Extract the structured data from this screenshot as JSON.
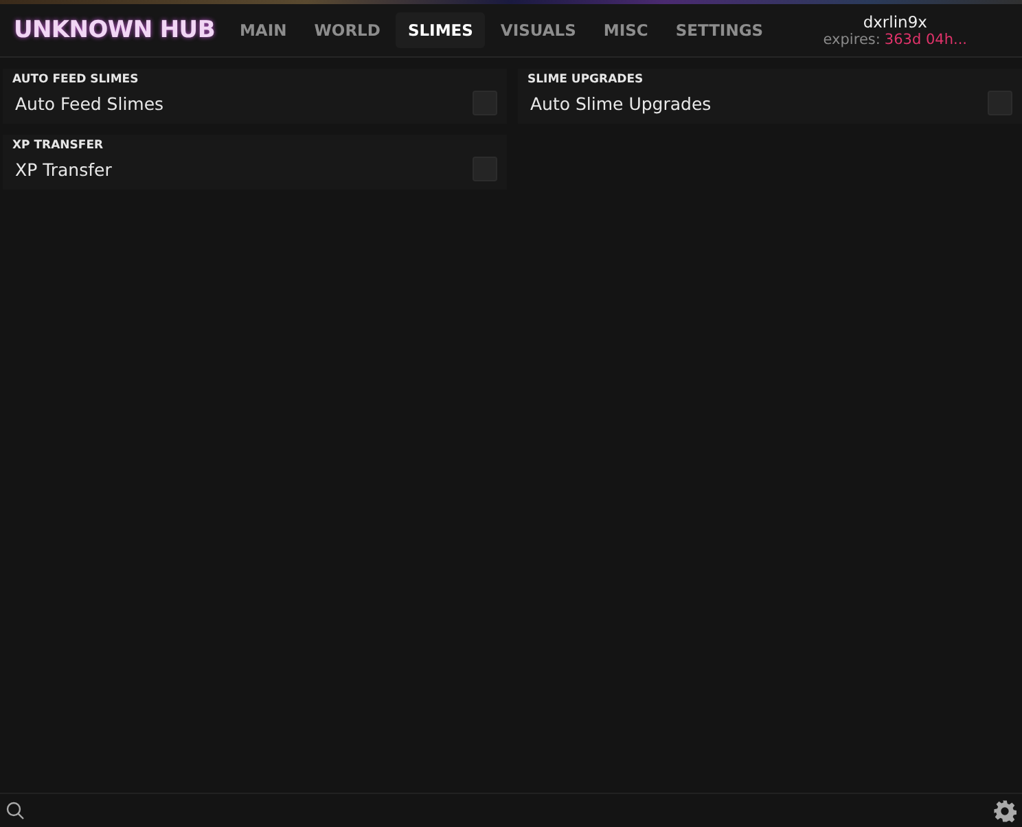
{
  "header": {
    "logo": "UNKNOWN HUB",
    "tabs": [
      {
        "label": "MAIN",
        "selected": false
      },
      {
        "label": "WORLD",
        "selected": false
      },
      {
        "label": "SLIMES",
        "selected": true
      },
      {
        "label": "VISUALS",
        "selected": false
      },
      {
        "label": "MISC",
        "selected": false
      },
      {
        "label": "SETTINGS",
        "selected": false
      }
    ],
    "user": {
      "name": "dxrlin9x",
      "expires_label": "expires:",
      "expires_value": "363d 04h..."
    }
  },
  "columns": [
    [
      {
        "title": "AUTO FEED SLIMES",
        "toggles": [
          {
            "label": "Auto Feed Slimes",
            "checked": false
          }
        ]
      },
      {
        "title": "XP TRANSFER",
        "toggles": [
          {
            "label": "XP Transfer",
            "checked": false
          }
        ]
      }
    ],
    [
      {
        "title": "SLIME UPGRADES",
        "toggles": [
          {
            "label": "Auto Slime Upgrades",
            "checked": false
          }
        ]
      }
    ]
  ]
}
